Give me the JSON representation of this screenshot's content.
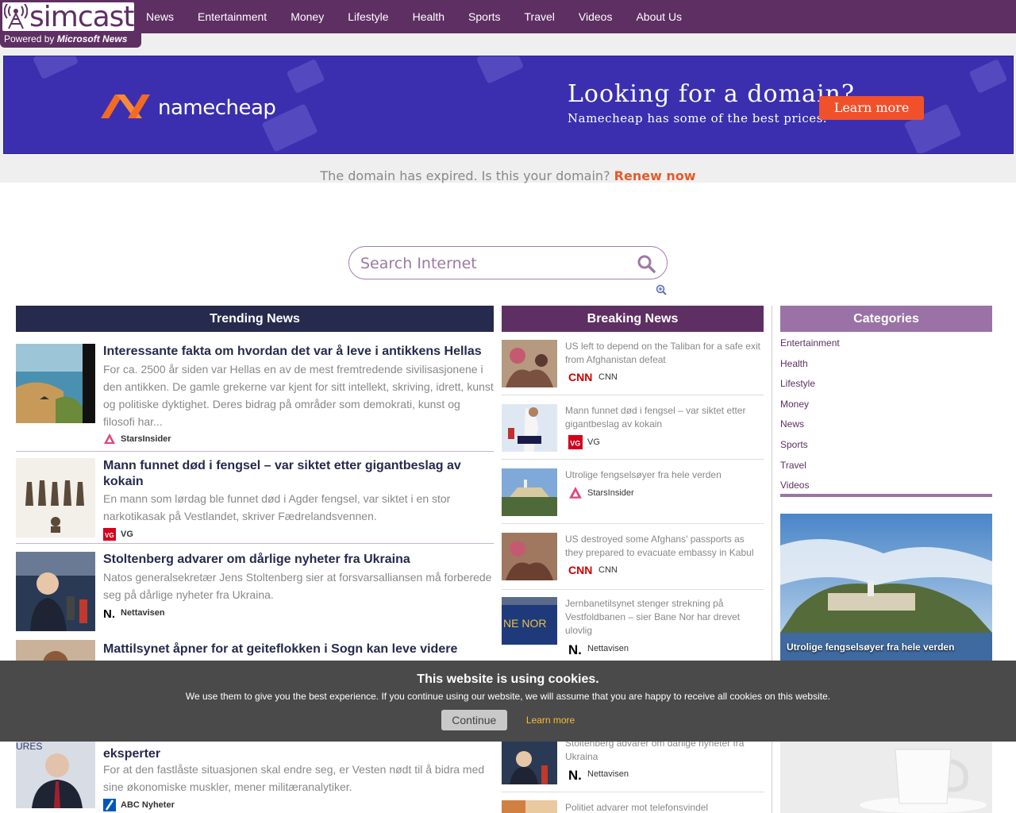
{
  "header": {
    "logo_text": "simcast",
    "powered_prefix": "Powered by",
    "powered_brand": "Microsoft News",
    "nav": [
      "News",
      "Entertainment",
      "Money",
      "Lifestyle",
      "Health",
      "Sports",
      "Travel",
      "Videos",
      "About Us"
    ]
  },
  "ad": {
    "brand": "namecheap",
    "headline": "Looking for a domain?",
    "subline": "Namecheap has some of the best prices.",
    "cta": "Learn more",
    "colors": {
      "background": "#3b2fb0",
      "button": "#f0512b"
    }
  },
  "expired": {
    "text": "The domain has expired. Is this your domain?",
    "link": "Renew now"
  },
  "search": {
    "placeholder": "Search Internet"
  },
  "sections": {
    "trending": "Trending News",
    "breaking": "Breaking News",
    "categories": "Categories"
  },
  "trending": [
    {
      "title": "Interessante fakta om hvordan det var å leve i antikkens Hellas",
      "desc": "For ca. 2500 år siden var Hellas en av de mest fremtredende sivilisasjonene i den antikken. De gamle grekerne var kjent for sitt intellekt, skriving, idrett, kunst og politiske dyktighet. Deres bidrag på områder som demokrati, kunst og filosofi har...",
      "source": "StarsInsider"
    },
    {
      "title": "Mann funnet død i fengsel – var siktet etter gigantbeslag av kokain",
      "desc": "En mann som lørdag ble funnet død i Agder fengsel, var siktet i en stor narkotikasak på Vestlandet, skriver Fædrelandsvennen.",
      "source": "VG"
    },
    {
      "title": "Stoltenberg advarer om dårlige nyheter fra Ukraina",
      "desc": "Natos generalsekretær Jens Stoltenberg sier at forsvarsalliansen må forberede seg på dårlige nyheter fra Ukraina.",
      "source": "Nettavisen"
    },
    {
      "title": "Mattilsynet åpner for at geiteflokken i Sogn kan leve videre",
      "desc": "",
      "source": ""
    },
    {
      "title": "eksperter",
      "desc": "For at den fastlåste situasjonen skal endre seg, er Vesten nødt til å bidra med sine økonomiske muskler, mener militæranalytiker.",
      "source": "ABC Nyheter"
    }
  ],
  "breaking": [
    {
      "title": "US left to depend on the Taliban for a safe exit from Afghanistan defeat",
      "source": "CNN"
    },
    {
      "title": "Mann funnet død i fengsel – var siktet etter gigantbeslag av kokain",
      "source": "VG"
    },
    {
      "title": "Utrolige fengselsøyer fra hele verden",
      "source": "StarsInsider"
    },
    {
      "title": "US destroyed some Afghans' passports as they prepared to evacuate embassy in Kabul",
      "source": "CNN"
    },
    {
      "title": "Jernbanetilsynet stenger strekning på Vestfoldbanen – sier Bane Nor har drevet ulovlig",
      "source": "Nettavisen"
    },
    {
      "title": "Stoltenberg advarer om dårlige nyheter fra Ukraina",
      "source": "Nettavisen"
    },
    {
      "title": "Politiet advarer mot telefonsvindel",
      "source": ""
    }
  ],
  "categories": [
    "Entertainment",
    "Health",
    "Lifestyle",
    "Money",
    "News",
    "Sports",
    "Travel",
    "Videos"
  ],
  "featured": {
    "caption": "Utrolige fengselsøyer fra hele verden"
  },
  "cookie": {
    "title": "This website is using cookies.",
    "text": "We use them to give you the best experience. If you continue using our website, we will assume that you are happy to receive all cookies on this website.",
    "continue": "Continue",
    "learn": "Learn more"
  },
  "colors": {
    "brand": "#5e2f63",
    "trending_header": "#262a4d",
    "categories_header": "#9b72a6",
    "renew_link": "#e55b2b"
  }
}
